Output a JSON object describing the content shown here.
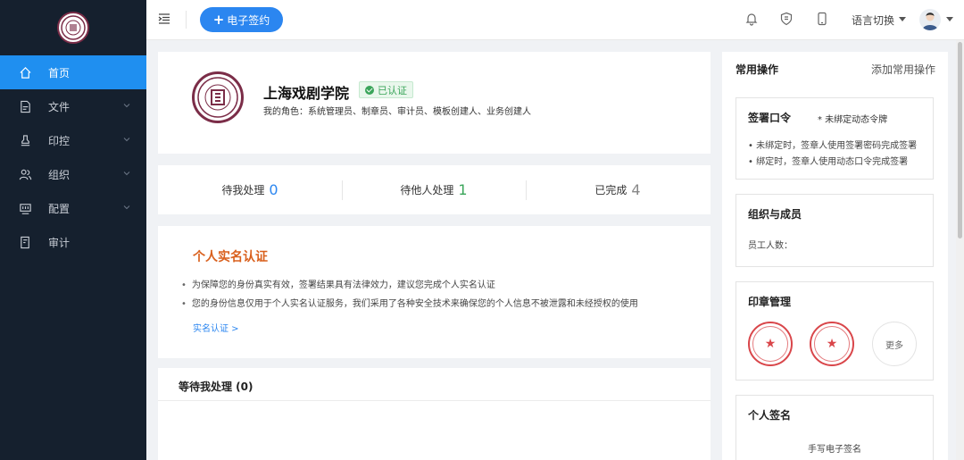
{
  "sidebar": {
    "items": [
      {
        "label": "首页",
        "icon": "home-icon",
        "active": true
      },
      {
        "label": "文件",
        "icon": "file-icon",
        "expandable": true
      },
      {
        "label": "印控",
        "icon": "stamp-icon",
        "expandable": true
      },
      {
        "label": "组织",
        "icon": "users-icon",
        "expandable": true
      },
      {
        "label": "配置",
        "icon": "config-icon",
        "expandable": true
      },
      {
        "label": "审计",
        "icon": "audit-icon",
        "expandable": false
      }
    ]
  },
  "topbar": {
    "new_sign_label": "电子签约",
    "language_label": "语言切换"
  },
  "org": {
    "name": "上海戏剧学院",
    "verified_label": "已认证",
    "roles": "我的角色：系统管理员、制章员、审计员、模板创建人、业务创建人"
  },
  "stats": [
    {
      "label": "待我处理",
      "count": "0",
      "color": "#2b86f0"
    },
    {
      "label": "待他人处理",
      "count": "1",
      "color": "#3aa55a"
    },
    {
      "label": "已完成",
      "count": "4",
      "color": "#888888"
    }
  ],
  "realname": {
    "title": "个人实名认证",
    "bullets": [
      "为保障您的身份真实有效，签署结果具有法律效力，建议您完成个人实名认证",
      "您的身份信息仅用于个人实名认证服务，我们采用了各种安全技术来确保您的个人信息不被泄露和未经授权的使用"
    ],
    "link": "实名认证 >"
  },
  "pending": {
    "title": "等待我处理 (0)"
  },
  "right": {
    "title": "常用操作",
    "add_label": "添加常用操作",
    "sign_password": {
      "title": "签署口令",
      "status": "* 未绑定动态令牌",
      "notes": [
        "• 未绑定时，签章人使用签署密码完成签署",
        "• 绑定时，签章人使用动态口令完成签署"
      ]
    },
    "org_members": {
      "title": "组织与成员",
      "employee_count_label": "员工人数："
    },
    "seal_mgmt": {
      "title": "印章管理",
      "more_label": "更多"
    },
    "personal_signature": {
      "title": "个人签名",
      "handwritten_label": "手写电子签名"
    }
  }
}
